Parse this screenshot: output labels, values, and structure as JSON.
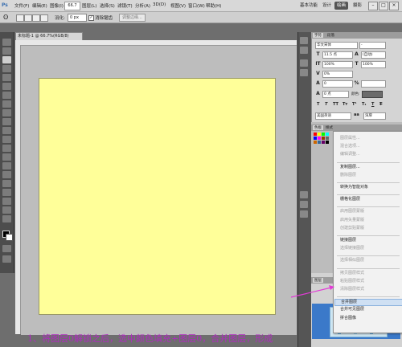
{
  "app": {
    "logo": "Ps"
  },
  "menubar": {
    "items": [
      "文件(F)",
      "编辑(E)",
      "图像(I)",
      "图层(L)",
      "选择(S)",
      "滤镜(T)",
      "分析(A)",
      "3D(D)",
      "视图(V)",
      "窗口(W)",
      "帮助(H)"
    ],
    "zoom": "66.7",
    "workspaces": [
      "基本功能",
      "设计",
      "绘画",
      "摄影"
    ]
  },
  "options_bar": {
    "feather_label": "羽化:",
    "feather_value": "0 px",
    "antialias_label": "消除锯齿",
    "refine_edge_button": "调整边缘..."
  },
  "document": {
    "tab_title": "未标题-1 @ 66.7%(RGB/8)"
  },
  "character_panel": {
    "tabs": [
      "字符",
      "段落"
    ],
    "font_family": "华文宋体",
    "font_size": "11.5 点",
    "leading": "(自动)",
    "vertical_scale": "100%",
    "horizontal_scale": "100%",
    "baseline_percent": "0%",
    "tracking": "0",
    "baseline_shift": "0 点",
    "color_label": "颜色:",
    "language": "美国英语",
    "antialias": "浑厚"
  },
  "swatches_tabs": [
    "色板",
    "样式"
  ],
  "layers_tab": "图层",
  "context_menu": {
    "items": [
      {
        "label": "图层属性...",
        "enabled": false
      },
      {
        "label": "混合选项...",
        "enabled": false
      },
      {
        "label": "编辑调整...",
        "enabled": false
      },
      {
        "label": "复制图层...",
        "enabled": true,
        "sep_before": true
      },
      {
        "label": "删除图层",
        "enabled": false
      },
      {
        "label": "转换为智能对象",
        "enabled": true,
        "sep_before": true
      },
      {
        "label": "栅格化图层",
        "enabled": true,
        "sep_before": true
      },
      {
        "label": "启用图层蒙版",
        "enabled": false,
        "sep_before": true
      },
      {
        "label": "启用矢量蒙版",
        "enabled": false
      },
      {
        "label": "创建剪贴蒙版",
        "enabled": false
      },
      {
        "label": "链接图层",
        "enabled": true,
        "sep_before": true
      },
      {
        "label": "选择链接图层",
        "enabled": false
      },
      {
        "label": "选择相似图层",
        "enabled": false,
        "sep_before": true
      },
      {
        "label": "拷贝图层样式",
        "enabled": false,
        "sep_before": true
      },
      {
        "label": "粘贴图层样式",
        "enabled": false
      },
      {
        "label": "清除图层样式",
        "enabled": false
      },
      {
        "label": "合并图层",
        "enabled": true,
        "highlighted": true,
        "sep_before": true
      },
      {
        "label": "合并可见图层",
        "enabled": true
      },
      {
        "label": "拼合图像",
        "enabled": true
      }
    ]
  },
  "annotation": {
    "caption": "1、将图层0解锁之后，选中颜色填充+图层0，合并图层，形成",
    "color": "#b02bc0"
  },
  "colors": {
    "canvas_fill": "#ffff99",
    "foreground": "#000000",
    "background": "#ffffff"
  }
}
